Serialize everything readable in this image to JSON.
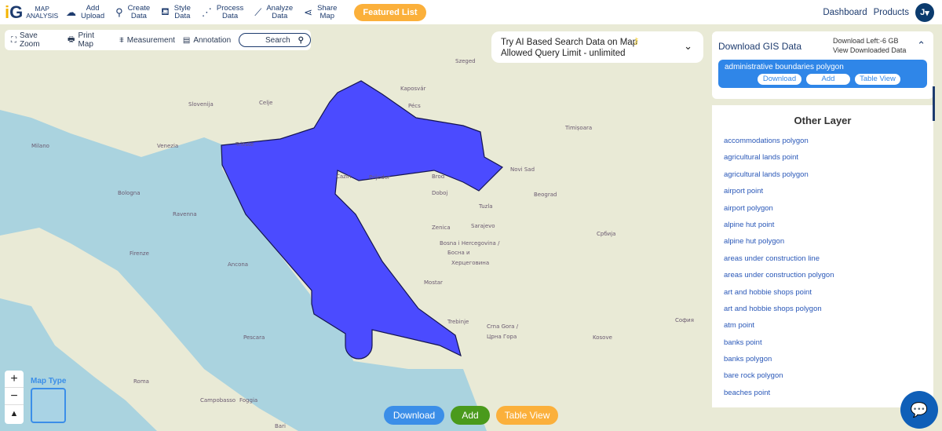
{
  "header": {
    "logo_top": "MAP",
    "logo_bottom": "ANALYSIS",
    "nav": [
      {
        "icon": "cloud-upload-icon",
        "l1": "Add",
        "l2": "Upload"
      },
      {
        "icon": "map-pin-icon",
        "l1": "Create",
        "l2": "Data"
      },
      {
        "icon": "paint-bucket-icon",
        "l1": "Style",
        "l2": "Data"
      },
      {
        "icon": "process-icon",
        "l1": "Process",
        "l2": "Data"
      },
      {
        "icon": "analyze-icon",
        "l1": "Analyze",
        "l2": "Data"
      },
      {
        "icon": "share-icon",
        "l1": "Share",
        "l2": "Map"
      }
    ],
    "featured": "Featured List",
    "dashboard": "Dashboard",
    "products": "Products",
    "avatar": "J"
  },
  "toolbar": {
    "save_zoom": "Save Zoom",
    "print_map": "Print Map",
    "measurement": "Measurement",
    "annotation": "Annotation",
    "search": "Search"
  },
  "ai": {
    "line1": "Try AI Based Search Data on Map",
    "line2": "Allowed Query Limit - unlimited"
  },
  "gis": {
    "title": "Download GIS Data",
    "download_left": "Download Left:-6 GB",
    "view_downloaded": "View Downloaded Data",
    "layer": "administrative boundaries polygon",
    "download": "Download",
    "add": "Add",
    "table_view": "Table View"
  },
  "other": {
    "title": "Other Layer",
    "items": [
      "accommodations polygon",
      "agricultural lands point",
      "agricultural lands polygon",
      "airport point",
      "airport polygon",
      "alpine hut point",
      "alpine hut polygon",
      "areas under construction line",
      "areas under construction polygon",
      "art and hobbie shops point",
      "art and hobbie shops polygon",
      "atm point",
      "banks point",
      "banks polygon",
      "bare rock polygon",
      "beaches point"
    ]
  },
  "map": {
    "map_type": "Map Type",
    "zoom_in": "+",
    "zoom_out": "−",
    "north": "▲",
    "labels": [
      "Slovenija",
      "Trieste",
      "Celje",
      "Kaposvár",
      "Pécs",
      "Szeged",
      "Timișoara",
      "Novi Sad",
      "Beograd",
      "Cazin",
      "Prijedor",
      "Brod",
      "Doboj",
      "Tuzla",
      "Zenica",
      "Bosna i Hercegovina /",
      "Босна и",
      "Херцеговина",
      "Mostar",
      "Trebinje",
      "Crna Gora /",
      "Црна Гора",
      "Venezia",
      "Bologna",
      "Firenze",
      "Ravenna",
      "Ancona",
      "Pescara",
      "Roma",
      "Campobasso",
      "Foggia",
      "Bari",
      "Србија",
      "Kosove",
      "София",
      "Milano",
      "Sarajevo"
    ],
    "polygon_color": "#4b4bff",
    "sea_color": "#aad3df",
    "land_color": "#e9ead6"
  },
  "bottom": {
    "download": "Download",
    "add": "Add",
    "table_view": "Table View"
  }
}
